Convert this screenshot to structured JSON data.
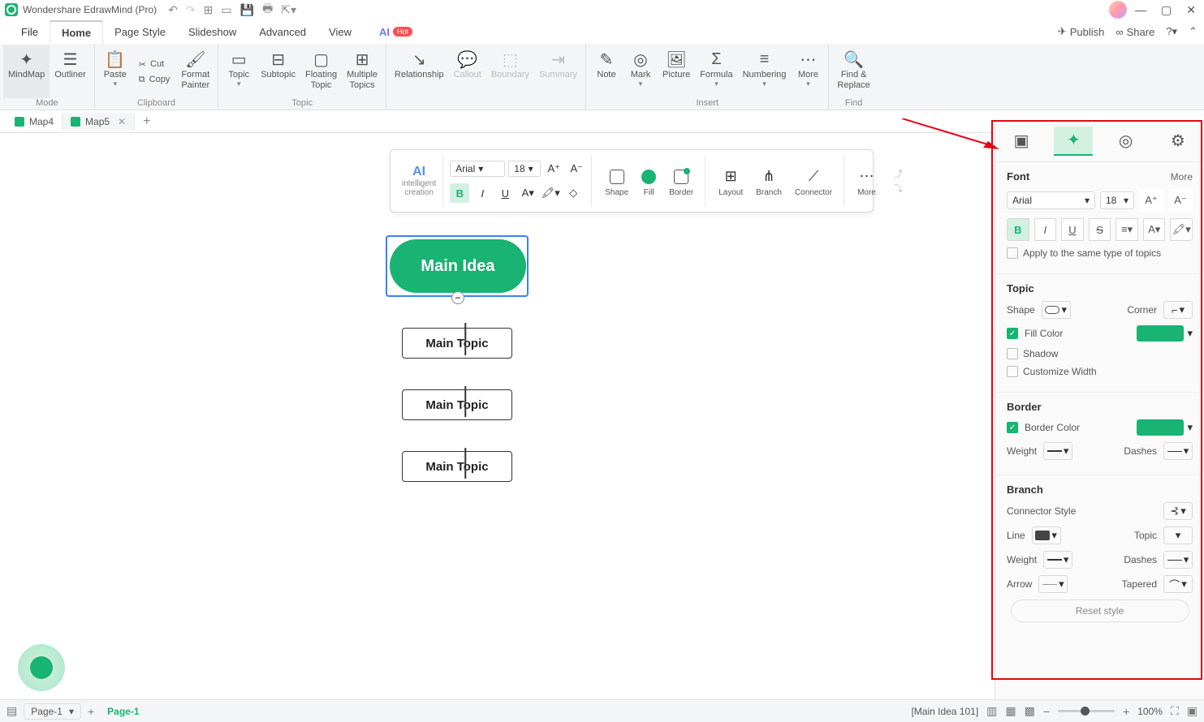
{
  "titlebar": {
    "title": "Wondershare EdrawMind (Pro)"
  },
  "menubar": {
    "file": "File",
    "tabs": [
      "Home",
      "Page Style",
      "Slideshow",
      "Advanced",
      "View"
    ],
    "ai": "AI",
    "hot": "Hot",
    "publish": "Publish",
    "share": "Share"
  },
  "ribbon": {
    "mode": {
      "label": "Mode",
      "mindmap": "MindMap",
      "outliner": "Outliner"
    },
    "clipboard": {
      "label": "Clipboard",
      "paste": "Paste",
      "cut": "Cut",
      "copy": "Copy",
      "format_painter": "Format\nPainter"
    },
    "topic": {
      "label": "Topic",
      "topic": "Topic",
      "subtopic": "Subtopic",
      "floating": "Floating\nTopic",
      "multiple": "Multiple\nTopics"
    },
    "relationship": "Relationship",
    "callout": "Callout",
    "boundary": "Boundary",
    "summary": "Summary",
    "insert": {
      "label": "Insert",
      "note": "Note",
      "mark": "Mark",
      "picture": "Picture",
      "formula": "Formula",
      "numbering": "Numbering",
      "more": "More"
    },
    "find": {
      "label": "Find",
      "findreplace": "Find &\nReplace"
    }
  },
  "doctabs": {
    "tabs": [
      "Map4",
      "Map5"
    ],
    "active": 1
  },
  "float_toolbar": {
    "ai": "AI",
    "ai_sub": "intelligent\ncreation",
    "font_family": "Arial",
    "font_size": "18",
    "shape": "Shape",
    "fill": "Fill",
    "border": "Border",
    "layout": "Layout",
    "branch": "Branch",
    "connector": "Connector",
    "more": "More"
  },
  "mindmap": {
    "main": "Main Idea",
    "subs": [
      "Main Topic",
      "Main Topic",
      "Main Topic"
    ]
  },
  "right_panel": {
    "font": {
      "title": "Font",
      "more": "More",
      "family": "Arial",
      "size": "18",
      "apply_same": "Apply to the same type of topics"
    },
    "topic": {
      "title": "Topic",
      "shape": "Shape",
      "corner": "Corner",
      "fill_color": "Fill Color",
      "shadow": "Shadow",
      "custom_width": "Customize Width"
    },
    "border": {
      "title": "Border",
      "border_color": "Border Color",
      "weight": "Weight",
      "dashes": "Dashes"
    },
    "branch": {
      "title": "Branch",
      "connector_style": "Connector Style",
      "line": "Line",
      "topic": "Topic",
      "weight": "Weight",
      "dashes": "Dashes",
      "arrow": "Arrow",
      "tapered": "Tapered"
    },
    "reset": "Reset style"
  },
  "statusbar": {
    "page_selector": "Page-1",
    "page_active": "Page-1",
    "selection": "[Main Idea 101]",
    "zoom": "100%"
  }
}
